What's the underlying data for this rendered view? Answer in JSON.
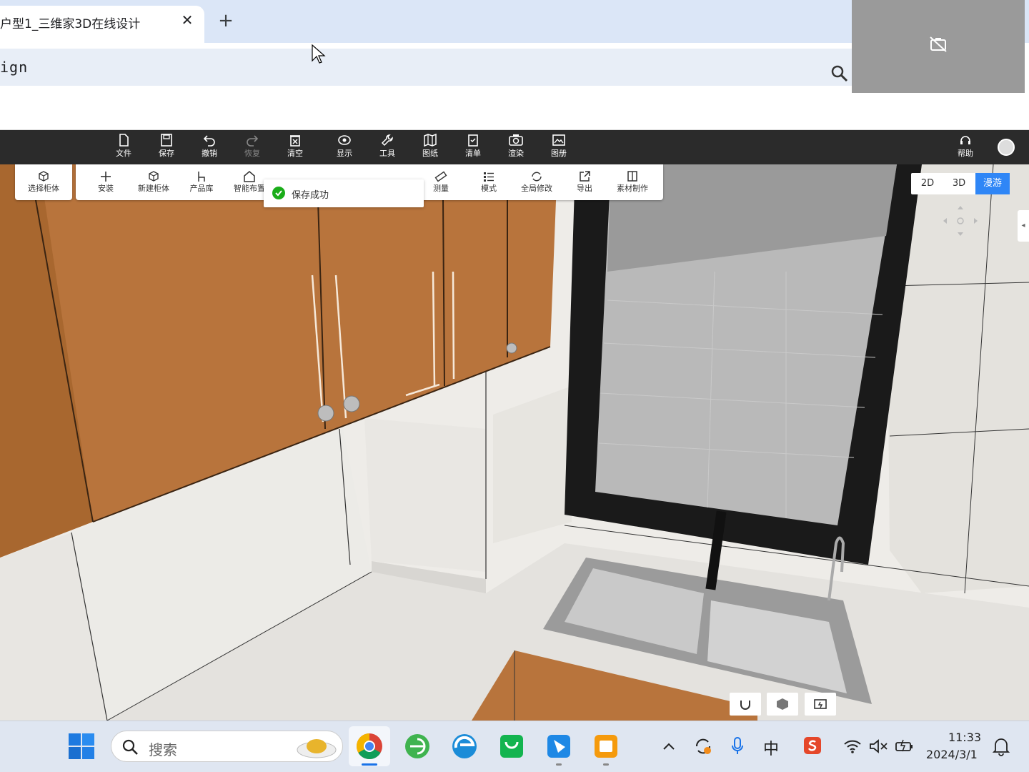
{
  "browser": {
    "tab_title": "户型1_三维家3D在线设计",
    "tab_close": "✕",
    "new_tab": "+",
    "address_text": "ign"
  },
  "toolbar": {
    "items": [
      {
        "label": "文件",
        "icon": "file-icon"
      },
      {
        "label": "保存",
        "icon": "save-icon"
      },
      {
        "label": "撤销",
        "icon": "undo-icon"
      },
      {
        "label": "恢复",
        "icon": "redo-icon"
      },
      {
        "label": "清空",
        "icon": "clear-icon"
      },
      {
        "label": "显示",
        "icon": "eye-icon"
      },
      {
        "label": "工具",
        "icon": "wrench-icon"
      },
      {
        "label": "图纸",
        "icon": "map-icon"
      },
      {
        "label": "清单",
        "icon": "clipboard-icon"
      },
      {
        "label": "渲染",
        "icon": "camera-icon"
      },
      {
        "label": "图册",
        "icon": "album-icon"
      }
    ],
    "help_label": "帮助"
  },
  "subtoolbar": {
    "select_cabinet": "选择柜体",
    "items": [
      "安装",
      "新建柜体",
      "产品库",
      "智能布置",
      "测量",
      "模式",
      "全局修改",
      "导出",
      "素材制作"
    ]
  },
  "toast": {
    "message": "保存成功"
  },
  "viewmode": {
    "two_d": "2D",
    "three_d": "3D",
    "roam": "漫游",
    "active": "漫游"
  },
  "taskbar": {
    "search_placeholder": "搜索",
    "ime": "中",
    "time": "11:33",
    "date": "2024/3/1"
  },
  "colors": {
    "toolbar_bg": "#2b2b2b",
    "accent": "#2f86f6",
    "toast_success": "#1aad19",
    "wood": "#b8743c"
  }
}
